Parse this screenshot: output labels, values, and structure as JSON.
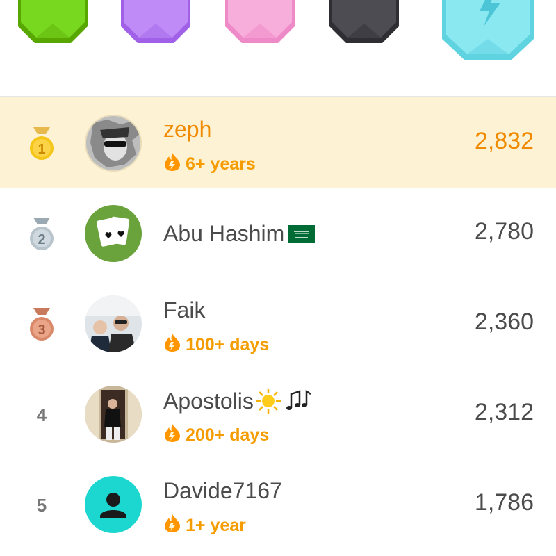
{
  "leagues": {
    "badges": [
      {
        "name": "green-league-badge",
        "color": "#6fd61d"
      },
      {
        "name": "purple-league-badge",
        "color": "#b57ef5"
      },
      {
        "name": "pink-league-badge",
        "color": "#f5a3d7"
      },
      {
        "name": "black-league-badge",
        "color": "#4b4b4b"
      },
      {
        "name": "diamond-league-badge",
        "color": "#7fe2ec"
      }
    ]
  },
  "leaderboard": {
    "rows": [
      {
        "rank": "1",
        "name": "zeph",
        "streak": "6+ years",
        "score": "2,832",
        "medal": "gold"
      },
      {
        "rank": "2",
        "name": "Abu Hashim",
        "streak": "",
        "score": "2,780",
        "medal": "silver"
      },
      {
        "rank": "3",
        "name": "Faik",
        "streak": "100+ days",
        "score": "2,360",
        "medal": "bronze"
      },
      {
        "rank": "4",
        "name": "Apostolis",
        "streak": "200+ days",
        "score": "2,312",
        "medal": ""
      },
      {
        "rank": "5",
        "name": "Davide7167",
        "streak": "1+ year",
        "score": "1,786",
        "medal": ""
      }
    ]
  },
  "colors": {
    "highlight_bg": "#fdf3d4",
    "highlight_text": "#f08a00",
    "streak_text": "#f59d00",
    "gold": "#f5c518",
    "silver": "#b0bec5",
    "bronze": "#d9896a"
  }
}
